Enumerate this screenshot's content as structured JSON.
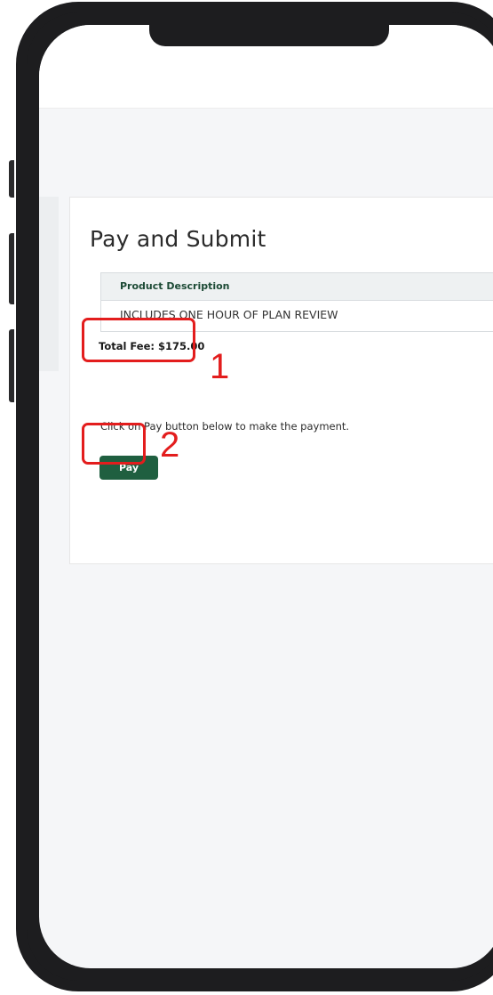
{
  "page": {
    "title": "Pay and Submit"
  },
  "product_table": {
    "header": "Product Description",
    "rows": [
      {
        "description": "INCLUDES ONE HOUR OF PLAN REVIEW"
      }
    ]
  },
  "total_fee": "Total Fee: $175.00",
  "pay_instruction": "Click on Pay button below to make the payment.",
  "pay_button_label": "Pay",
  "annotations": [
    {
      "label": "1",
      "color": "#e31d1d"
    },
    {
      "label": "2",
      "color": "#e31d1d"
    }
  ],
  "colors": {
    "accent": "#1f5f40",
    "annotation": "#e31d1d",
    "screen_background": "#f5f6f8",
    "phone_frame": "#1d1d1f"
  }
}
